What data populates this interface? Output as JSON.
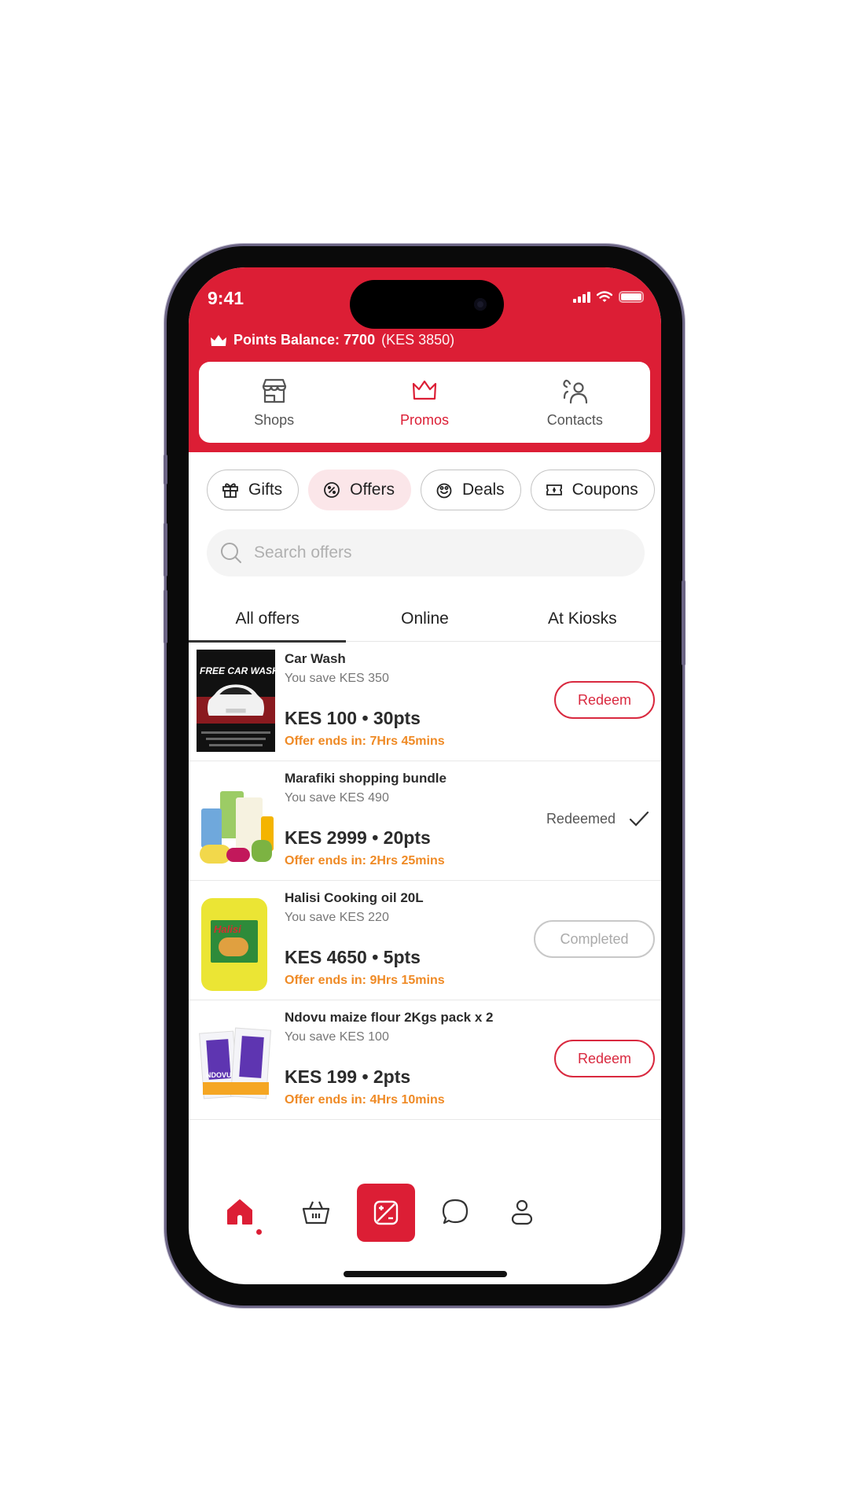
{
  "status_bar": {
    "time": "9:41"
  },
  "header": {
    "points_label": "Points Balance: 7700",
    "points_kes": "(KES 3850)",
    "accent_color": "#dc1e35"
  },
  "top_nav": [
    {
      "label": "Shops",
      "icon": "shop-icon",
      "active": false
    },
    {
      "label": "Promos",
      "icon": "crown-icon",
      "active": true
    },
    {
      "label": "Contacts",
      "icon": "contacts-icon",
      "active": false
    }
  ],
  "chips": [
    {
      "label": "Gifts",
      "icon": "gift-icon",
      "active": false
    },
    {
      "label": "Offers",
      "icon": "percent-badge-icon",
      "active": true
    },
    {
      "label": "Deals",
      "icon": "deals-icon",
      "active": false
    },
    {
      "label": "Coupons",
      "icon": "coupon-icon",
      "active": false
    }
  ],
  "search": {
    "placeholder": "Search offers",
    "value": ""
  },
  "tabs": [
    {
      "label": "All offers",
      "active": true
    },
    {
      "label": "Online",
      "active": false
    },
    {
      "label": "At Kiosks",
      "active": false
    }
  ],
  "offers": [
    {
      "title": "Car Wash",
      "save": "You save KES 350",
      "price": "KES 100 • 30pts",
      "ends": "Offer ends in: 7Hrs 45mins",
      "status": "redeem",
      "action_label": "Redeem",
      "thumb_text": "FREE CAR WASH"
    },
    {
      "title": "Marafiki shopping bundle",
      "save": "You save KES 490",
      "price": "KES 2999 • 20pts",
      "ends": "Offer ends in: 2Hrs 25mins",
      "status": "redeemed",
      "action_label": "Redeemed"
    },
    {
      "title": "Halisi Cooking oil 20L",
      "save": "You save KES 220",
      "price": "KES 4650 • 5pts",
      "ends": "Offer ends in: 9Hrs 15mins",
      "status": "completed",
      "action_label": "Completed",
      "thumb_text": "Halisi"
    },
    {
      "title": "Ndovu maize flour 2Kgs pack x 2",
      "save": "You save KES 100",
      "price": "KES 199 • 2pts",
      "ends": "Offer ends in: 4Hrs 10mins",
      "status": "redeem",
      "action_label": "Redeem",
      "thumb_text": "NDOVU"
    }
  ],
  "bottom_nav": [
    {
      "name": "home",
      "icon": "home-icon",
      "active": true
    },
    {
      "name": "basket",
      "icon": "basket-icon",
      "active": false
    },
    {
      "name": "promos",
      "icon": "promo-percent-icon",
      "active": false
    },
    {
      "name": "chat",
      "icon": "chat-bubble-icon",
      "active": false
    },
    {
      "name": "profile",
      "icon": "user-icon",
      "active": false
    }
  ]
}
